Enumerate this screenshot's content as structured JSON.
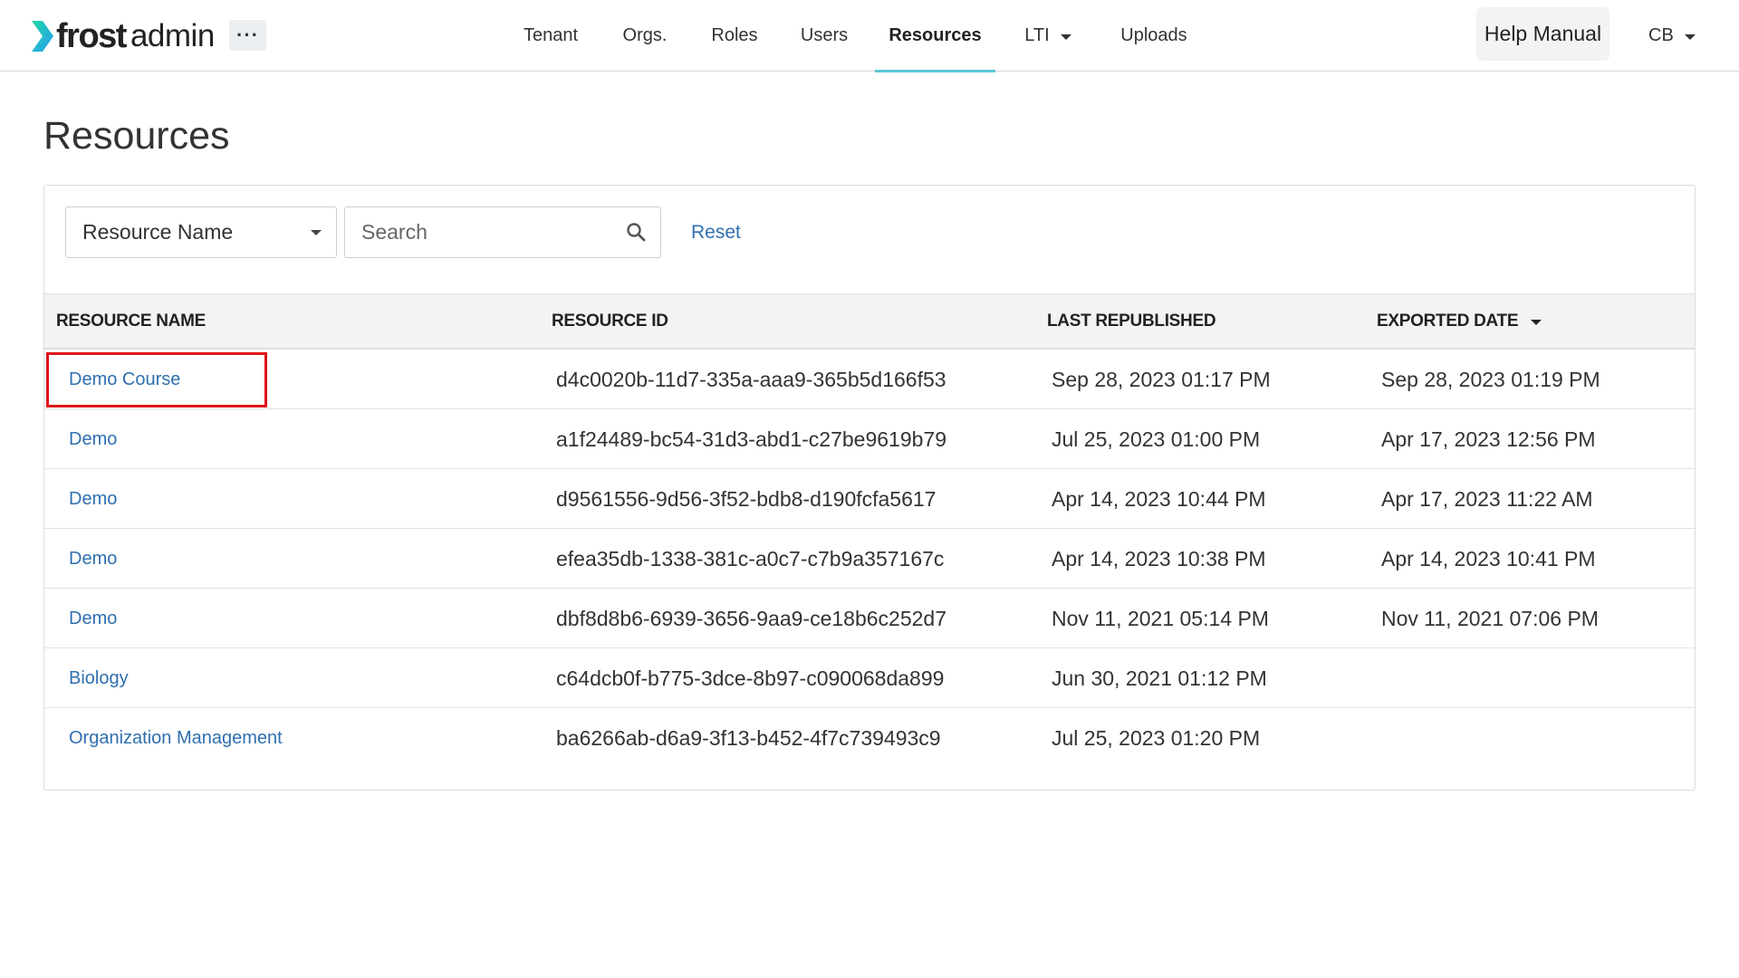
{
  "app": {
    "logo_brand": "frost",
    "logo_suffix": "admin",
    "more_label": "···"
  },
  "nav": {
    "tenant": "Tenant",
    "orgs": "Orgs.",
    "roles": "Roles",
    "users": "Users",
    "resources": "Resources",
    "lti": "LTI",
    "uploads": "Uploads",
    "help": "Help Manual",
    "user_initials": "CB"
  },
  "page": {
    "title": "Resources"
  },
  "filters": {
    "field_selected": "Resource Name",
    "search_placeholder": "Search",
    "search_value": "",
    "reset_label": "Reset"
  },
  "table": {
    "headers": {
      "name": "RESOURCE NAME",
      "id": "RESOURCE ID",
      "last_republished": "LAST REPUBLISHED",
      "exported_date": "EXPORTED DATE"
    },
    "sort_column": "exported_date",
    "rows": [
      {
        "name": "Demo Course",
        "id": "d4c0020b-11d7-335a-aaa9-365b5d166f53",
        "last_republished": "Sep 28, 2023 01:17 PM",
        "exported_date": "Sep 28, 2023 01:19 PM"
      },
      {
        "name": "Demo",
        "id": "a1f24489-bc54-31d3-abd1-c27be9619b79",
        "last_republished": "Jul 25, 2023 01:00 PM",
        "exported_date": "Apr 17, 2023 12:56 PM"
      },
      {
        "name": "Demo",
        "id": "d9561556-9d56-3f52-bdb8-d190fcfa5617",
        "last_republished": "Apr 14, 2023 10:44 PM",
        "exported_date": "Apr 17, 2023 11:22 AM"
      },
      {
        "name": "Demo",
        "id": "efea35db-1338-381c-a0c7-c7b9a357167c",
        "last_republished": "Apr 14, 2023 10:38 PM",
        "exported_date": "Apr 14, 2023 10:41 PM"
      },
      {
        "name": "Demo",
        "id": "dbf8d8b6-6939-3656-9aa9-ce18b6c252d7",
        "last_republished": "Nov 11, 2021 05:14 PM",
        "exported_date": "Nov 11, 2021 07:06 PM"
      },
      {
        "name": "Biology",
        "id": "c64dcb0f-b775-3dce-8b97-c090068da899",
        "last_republished": "Jun 30, 2021 01:12 PM",
        "exported_date": ""
      },
      {
        "name": "Organization Management",
        "id": "ba6266ab-d6a9-3f13-b452-4f7c739493c9",
        "last_republished": "Jul 25, 2023 01:20 PM",
        "exported_date": ""
      }
    ]
  },
  "colors": {
    "link": "#2f6fb0",
    "active_tab_underline": "#5cc9d9",
    "logo_gradient_start": "#1fd8a4",
    "logo_gradient_end": "#2a9df4",
    "highlight": "#e0121b"
  }
}
